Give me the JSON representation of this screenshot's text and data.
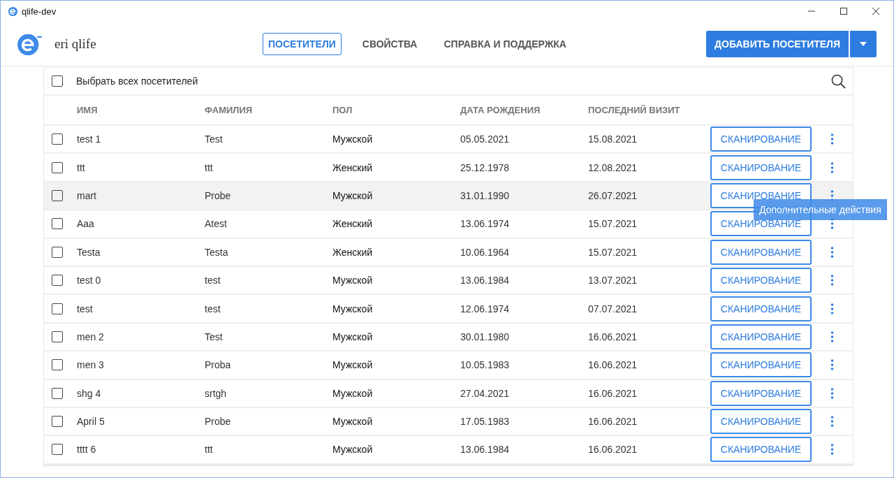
{
  "window": {
    "title": "qlife-dev"
  },
  "app": {
    "logo_text": "eri qlife"
  },
  "nav": [
    {
      "label": "ПОСЕТИТЕЛИ",
      "selected": true
    },
    {
      "label": "СВОЙСТВА",
      "selected": false
    },
    {
      "label": "СПРАВКА И ПОДДЕРЖКА",
      "selected": false
    }
  ],
  "add_button": {
    "label": "ДОБАВИТЬ ПОСЕТИТЕЛЯ"
  },
  "select_all": {
    "label": "Выбрать всех посетителей",
    "checked": false
  },
  "table": {
    "columns": [
      "ИМЯ",
      "ФАМИЛИЯ",
      "ПОЛ",
      "ДАТА РОЖДЕНИЯ",
      "ПОСЛЕДНИЙ ВИЗИТ"
    ],
    "rows": [
      {
        "cells": [
          "test 1",
          "Test",
          "Мужской",
          "05.05.2021",
          "15.08.2021"
        ],
        "checked": false,
        "hovered": false,
        "action": "СКАНИРОВАНИЕ"
      },
      {
        "cells": [
          "ttt",
          "ttt",
          "Женский",
          "25.12.1978",
          "12.08.2021"
        ],
        "checked": false,
        "hovered": false,
        "action": "СКАНИРОВАНИЕ"
      },
      {
        "cells": [
          "mart",
          "Probe",
          "Мужской",
          "31.01.1990",
          "26.07.2021"
        ],
        "checked": false,
        "hovered": true,
        "action": "СКАНИРОВАНИЕ",
        "tooltip": "Дополнительные действия"
      },
      {
        "cells": [
          "Aaa",
          "Atest",
          "Женский",
          "13.06.1974",
          "15.07.2021"
        ],
        "checked": false,
        "hovered": false,
        "action": "СКАНИРОВАНИЕ"
      },
      {
        "cells": [
          "Testa",
          "Testa",
          "Женский",
          "10.06.1964",
          "15.07.2021"
        ],
        "checked": false,
        "hovered": false,
        "action": "СКАНИРОВАНИЕ"
      },
      {
        "cells": [
          "test 0",
          "test",
          "Мужской",
          "13.06.1984",
          "13.07.2021"
        ],
        "checked": false,
        "hovered": false,
        "action": "СКАНИРОВАНИЕ"
      },
      {
        "cells": [
          "test",
          "test",
          "Мужской",
          "12.06.1974",
          "07.07.2021"
        ],
        "checked": false,
        "hovered": false,
        "action": "СКАНИРОВАНИЕ"
      },
      {
        "cells": [
          "men 2",
          "Test",
          "Мужской",
          "30.01.1980",
          "16.06.2021"
        ],
        "checked": false,
        "hovered": false,
        "action": "СКАНИРОВАНИЕ"
      },
      {
        "cells": [
          "men 3",
          "Proba",
          "Мужской",
          "10.05.1983",
          "16.06.2021"
        ],
        "checked": false,
        "hovered": false,
        "action": "СКАНИРОВАНИЕ"
      },
      {
        "cells": [
          "shg 4",
          "srtgh",
          "Мужской",
          "27.04.2021",
          "16.06.2021"
        ],
        "checked": false,
        "hovered": false,
        "action": "СКАНИРОВАНИЕ"
      },
      {
        "cells": [
          "April 5",
          "Probe",
          "Мужской",
          "17.05.1983",
          "16.06.2021"
        ],
        "checked": false,
        "hovered": false,
        "action": "СКАНИРОВАНИЕ"
      },
      {
        "cells": [
          "tttt 6",
          "ttt",
          "Мужской",
          "13.06.1984",
          "16.06.2021"
        ],
        "checked": false,
        "hovered": false,
        "action": "СКАНИРОВАНИЕ"
      }
    ]
  }
}
